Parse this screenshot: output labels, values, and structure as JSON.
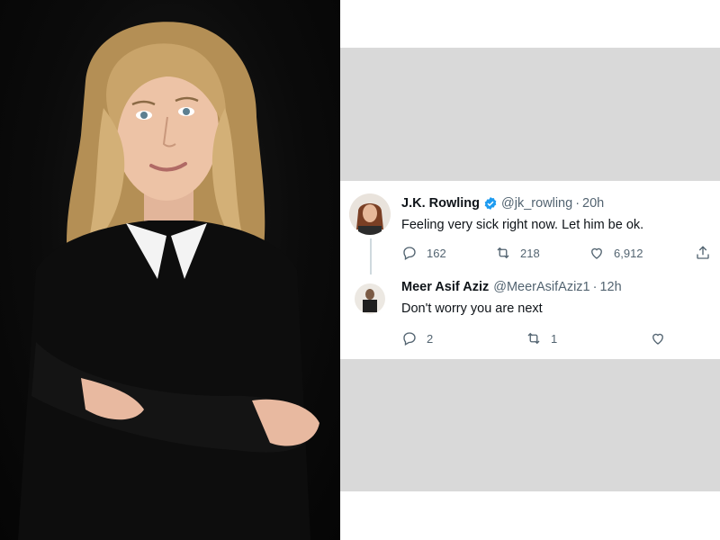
{
  "tweets": [
    {
      "name": "J.K. Rowling",
      "handle": "@jk_rowling",
      "separator": "·",
      "time": "20h",
      "text": "Feeling very sick right now. Let him be ok.",
      "verified": true,
      "replies": "162",
      "retweets": "218",
      "likes": "6,912"
    },
    {
      "name": "Meer Asif Aziz",
      "handle": "@MeerAsifAziz1",
      "separator": "·",
      "time": "12h",
      "text": "Don't worry you are next",
      "verified": false,
      "replies": "2",
      "retweets": "1",
      "likes": ""
    }
  ],
  "colors": {
    "verified": "#1d9bf0",
    "muted": "#536471",
    "text": "#0f1419",
    "panel_gray": "#d9d9d9"
  },
  "icons": [
    "reply-icon",
    "retweet-icon",
    "like-icon",
    "share-icon",
    "verified-badge-icon"
  ]
}
